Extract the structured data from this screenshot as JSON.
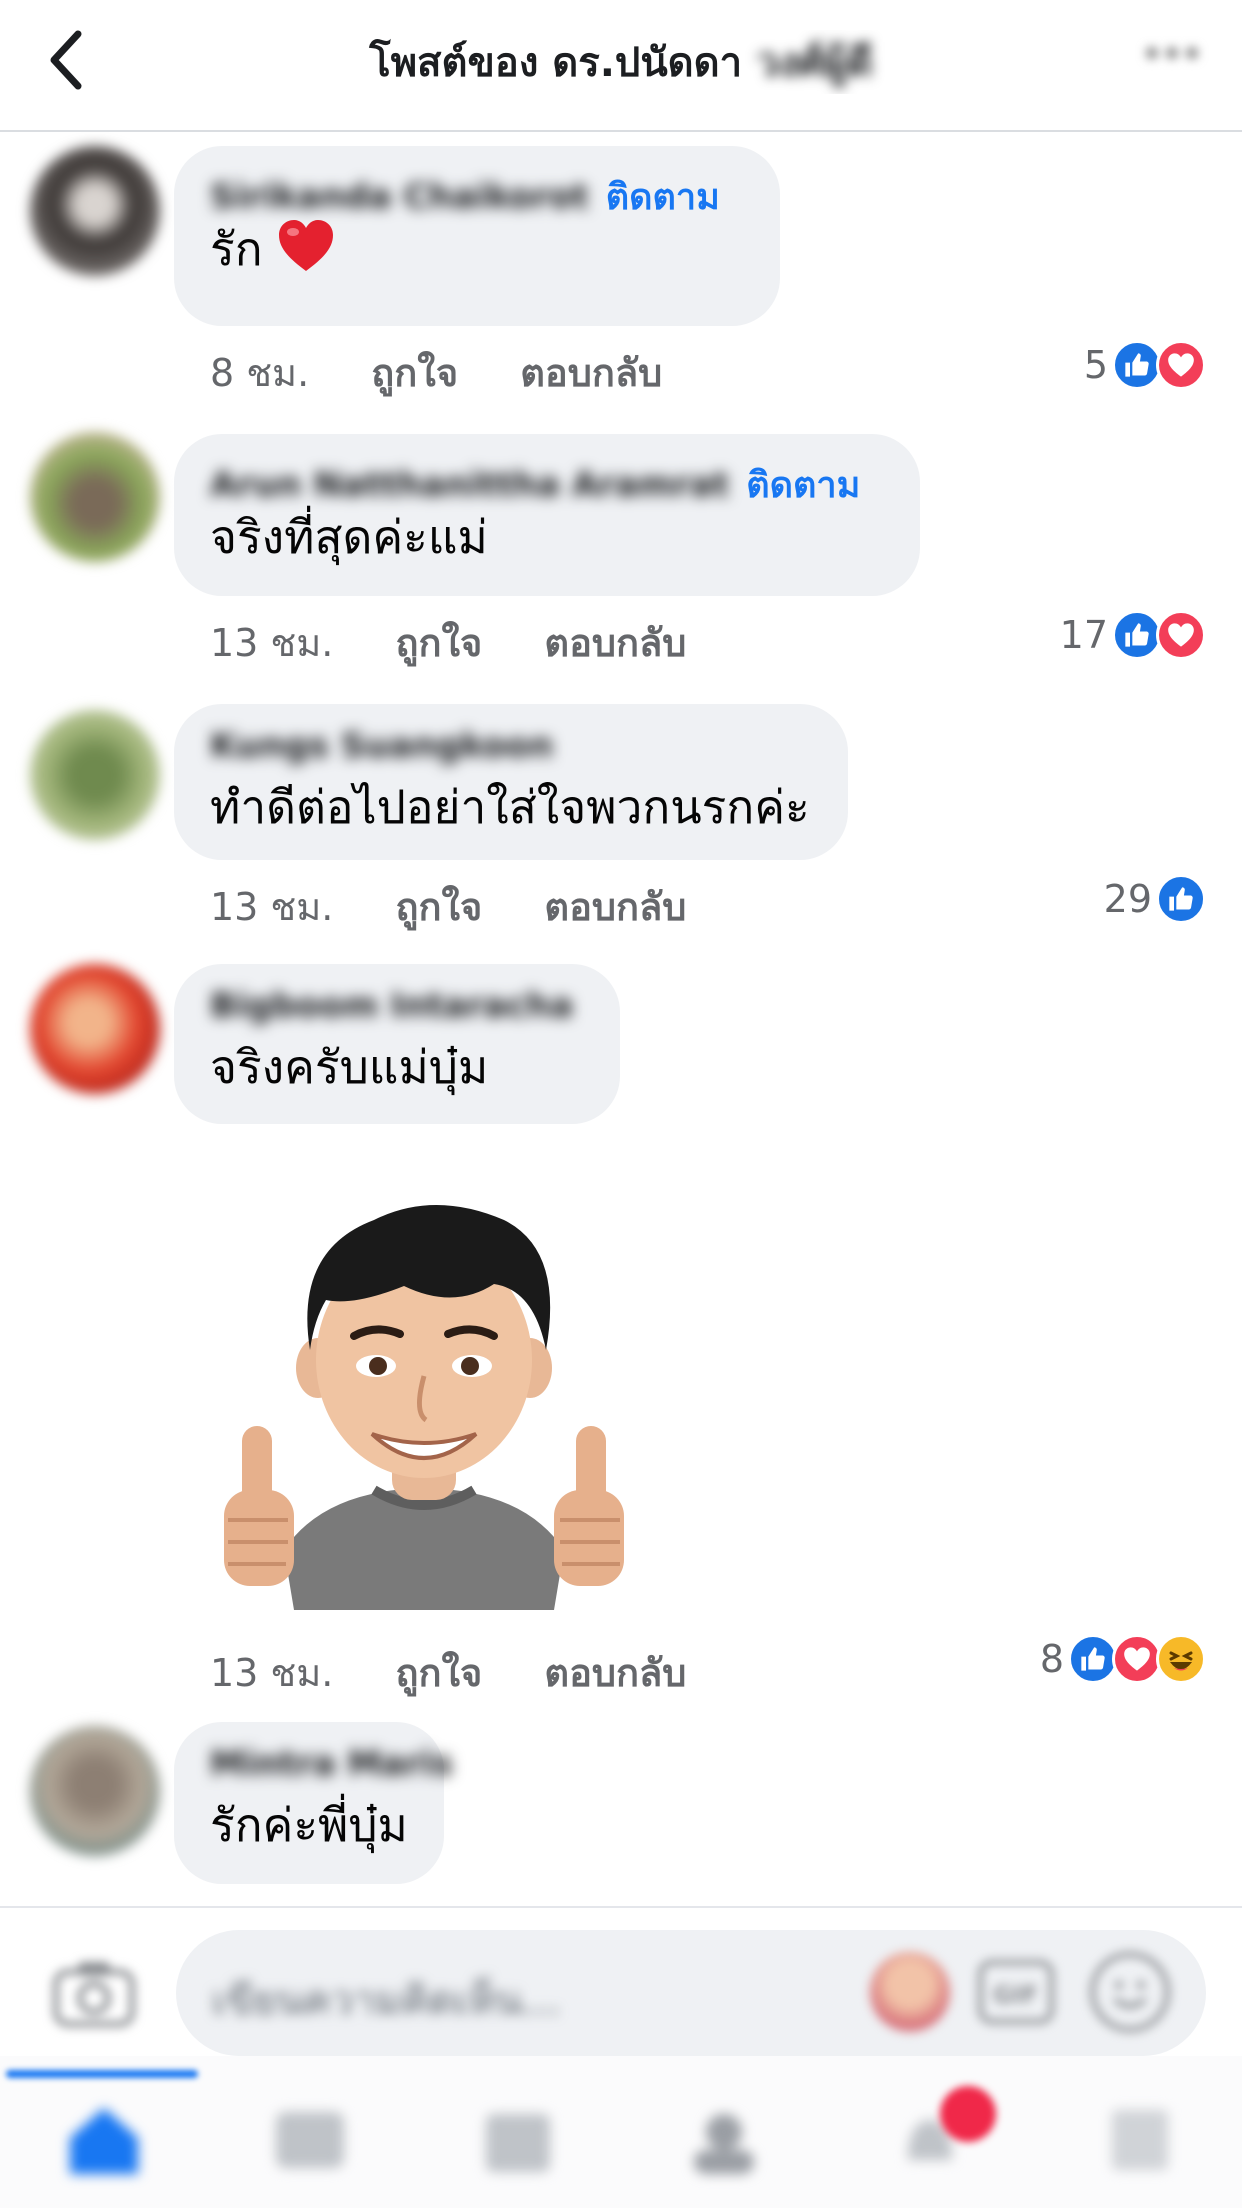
{
  "header": {
    "title": "โพสต์ของ ดร.ปนัดดา ",
    "title_blurred": "วงศ์ผู้ดี"
  },
  "comments": [
    {
      "name": "Sirikanda Chaikorot",
      "follow_label": "ติดตาม",
      "text": "รัก",
      "time": "8 ชม.",
      "like_label": "ถูกใจ",
      "reply_label": "ตอบกลับ",
      "reaction_count": "5",
      "reactions": [
        "like",
        "love"
      ]
    },
    {
      "name": "Arun Natthanittha Aramrat",
      "follow_label": "ติดตาม",
      "text": "จริงที่สุดค่ะแม่",
      "time": "13 ชม.",
      "like_label": "ถูกใจ",
      "reply_label": "ตอบกลับ",
      "reaction_count": "17",
      "reactions": [
        "like",
        "love"
      ]
    },
    {
      "name": "Kungs Suangkoon",
      "text": "ทำดีต่อไปอย่าใส่ใจพวกนรกค่ะ",
      "time": "13 ชม.",
      "like_label": "ถูกใจ",
      "reply_label": "ตอบกลับ",
      "reaction_count": "29",
      "reactions": [
        "like"
      ]
    },
    {
      "name": "Bigboom Intaracha",
      "text": "จริงครับแม่บุ๋ม",
      "time": "13 ชม.",
      "like_label": "ถูกใจ",
      "reply_label": "ตอบกลับ",
      "reaction_count": "8",
      "reactions": [
        "like",
        "love",
        "haha"
      ],
      "sticker": "avatar-thumbs-up-sticker"
    },
    {
      "name": "Mintra Maris",
      "text": "รักค่ะพี่บุ๋ม"
    }
  ],
  "composer": {
    "placeholder": "เขียนความคิดเห็น..."
  },
  "tabs": [
    "home-icon",
    "watch-icon",
    "marketplace-icon",
    "groups-icon",
    "notifications-icon",
    "menu-icon"
  ],
  "colors": {
    "accent": "#1877f2",
    "bubble": "#eff1f4",
    "like": "#1b74e4",
    "love": "#f33e58",
    "haha": "#f7b928"
  }
}
